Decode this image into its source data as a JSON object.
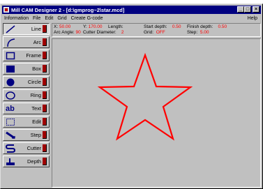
{
  "window": {
    "title": "Mill CAM Designer 2 - [d:\\gmprog~2\\star.mcd]",
    "minimize": "_",
    "maximize": "□",
    "close": "×"
  },
  "menu": {
    "items": [
      "Information",
      "File",
      "Edit",
      "Grid",
      "Create G-code"
    ],
    "help": "Help"
  },
  "status": {
    "x_label": "X:",
    "x_value": "50.00",
    "y_label": "Y:",
    "y_value": "170.00",
    "length_label": "Length:",
    "length_value": "",
    "arc_angle_label": "Arc Angle:",
    "arc_angle_value": "90",
    "cutter_diameter_label": "Cutter Diameter:",
    "cutter_diameter_value": "2",
    "start_depth_label": "Start depth:",
    "start_depth_value": "0.50",
    "grid_label": "Grid:",
    "grid_value": "OFF",
    "finish_depth_label": "Finish depth:",
    "finish_depth_value": "0.50",
    "step_label": "Step:",
    "step_value": "5.00"
  },
  "tools": [
    {
      "label": "Line",
      "icon": "line-icon"
    },
    {
      "label": "Arc",
      "icon": "arc-icon"
    },
    {
      "label": "Frame",
      "icon": "frame-icon"
    },
    {
      "label": "Box",
      "icon": "box-icon"
    },
    {
      "label": "Circle",
      "icon": "circle-icon"
    },
    {
      "label": "Ring",
      "icon": "ring-icon"
    },
    {
      "label": "Text",
      "icon": "text-icon",
      "glyph": "ab"
    },
    {
      "label": "Edit",
      "icon": "edit-icon"
    },
    {
      "label": "Step",
      "icon": "step-icon"
    },
    {
      "label": "Cutter",
      "icon": "cutter-icon"
    },
    {
      "label": "Depth",
      "icon": "depth-icon"
    }
  ],
  "drawing": {
    "shape": "star",
    "stroke_color": "#ff0000",
    "background": "#c0c0c0"
  },
  "colors": {
    "title_bar": "#000080",
    "face": "#c0c0c0",
    "tool_swatch": "#a00000",
    "value_text": "#ff0000"
  }
}
